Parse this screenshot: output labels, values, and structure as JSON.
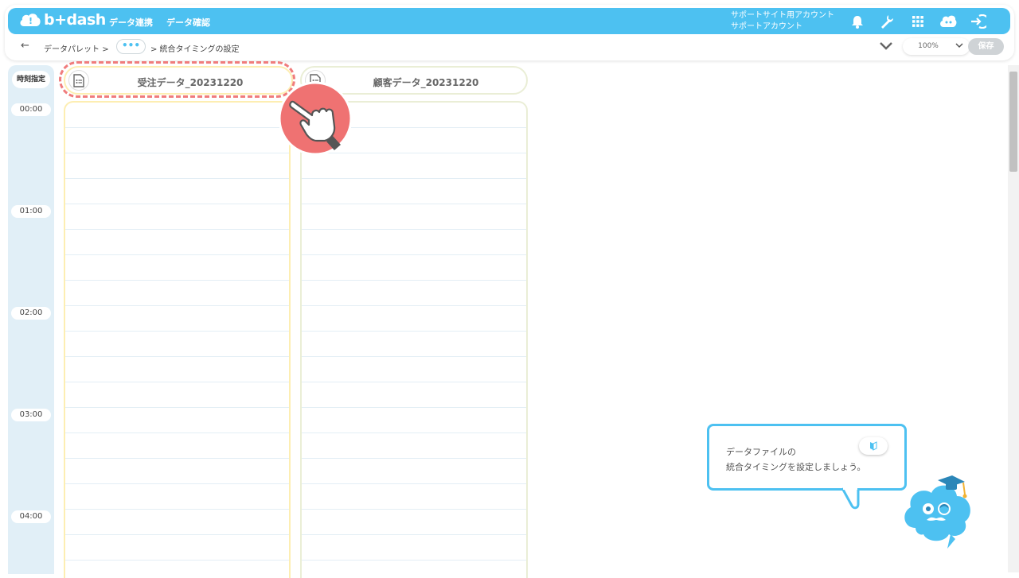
{
  "brand": {
    "logo_text": "b+dash",
    "accent": "#4dc1f1"
  },
  "nav": {
    "items": [
      {
        "label": "データ連携"
      },
      {
        "label": "データ確認"
      }
    ]
  },
  "account": {
    "line1": "サポートサイト用アカウント",
    "line2": "サポートアカウント"
  },
  "header_icons": [
    "bell-icon",
    "wrench-icon",
    "grid-icon",
    "mascot-icon",
    "logout-icon"
  ],
  "breadcrumb": {
    "back": "←",
    "item1": "データパレット",
    "sep": ">",
    "more": "•••",
    "current": "> 統合タイミングの設定"
  },
  "toolbar": {
    "zoom": "100%",
    "save_label": "保存"
  },
  "timeline": {
    "spec_label": "時刻指定",
    "hours": [
      "00:00",
      "01:00",
      "02:00",
      "03:00",
      "04:00"
    ]
  },
  "columns": [
    {
      "title": "受注データ_20231220",
      "highlighted": true
    },
    {
      "title": "顧客データ_20231220",
      "highlighted": false
    }
  ],
  "tip": {
    "line1": "データファイルの",
    "line2": "統合タイミングを設定しましょう。"
  }
}
